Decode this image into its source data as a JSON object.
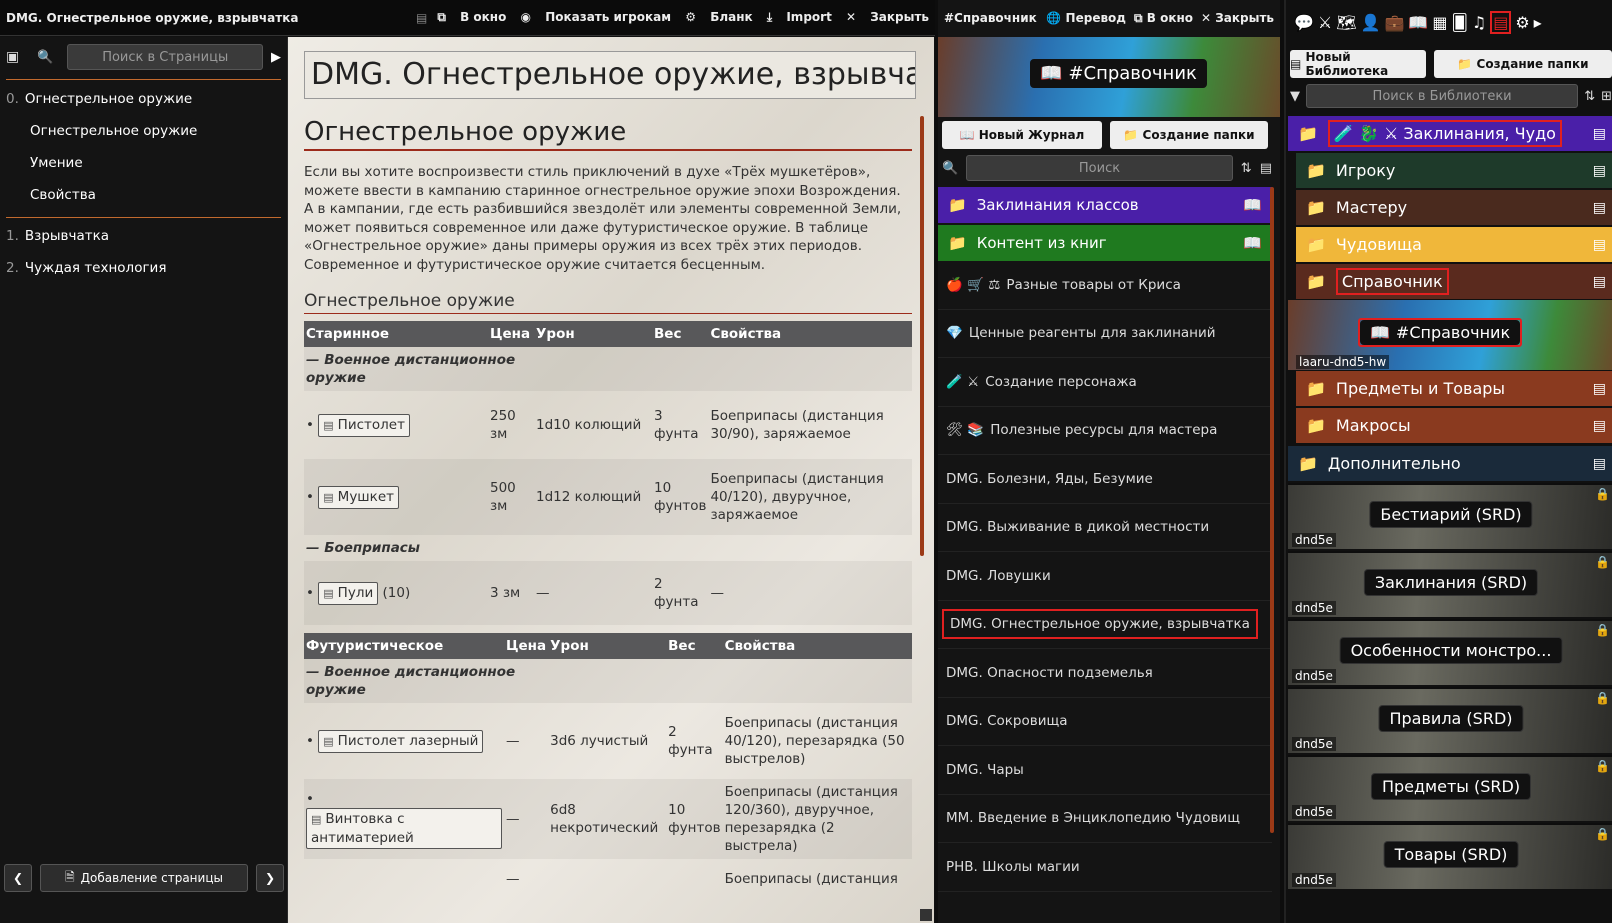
{
  "journal": {
    "title": "DMG. Огнестрельное оружие, взрывчатка",
    "toolbar": {
      "popout": "В окно",
      "show_players": "Показать игрокам",
      "blank": "Бланк",
      "import": "Import",
      "close": "Закрыть"
    },
    "search_placeholder": "Поиск в Страницы",
    "pages": [
      {
        "num": "0.",
        "label": "Огнестрельное оружие"
      },
      {
        "num": "",
        "label": "Огнестрельное оружие"
      },
      {
        "num": "",
        "label": "Умение"
      },
      {
        "num": "",
        "label": "Свойства"
      },
      {
        "num": "1.",
        "label": "Взрывчатка"
      },
      {
        "num": "2.",
        "label": "Чуждая технология"
      }
    ],
    "add_page": "Добавление страницы",
    "page_title": "DMG. Огнестрельное оружие, взрывчатка",
    "heading": "Огнестрельное оружие",
    "intro": "Если вы хотите воспроизвести стиль приключений в духе «Трёх мушкетёров», можете ввести в кампанию старинное огнестрельное оружие эпохи Возрождения. А в кампании, где есть разбившийся звездолёт или элементы современной Земли, может появиться современное или даже футуристическое оружие. В таблице «Огнестрельное оружие» даны примеры оружия из всех трёх этих периодов. Современное и футуристическое оружие считается бесценным.",
    "subheading": "Огнестрельное оружие",
    "table1": {
      "headers": [
        "Старинное",
        "Цена",
        "Урон",
        "Вес",
        "Свойства"
      ],
      "group1": "— Военное дистанционное оружие",
      "rows": [
        {
          "name": "Пистолет",
          "extra": "",
          "price": "250 зм",
          "damage": "1d10 колющий",
          "weight": "3 фунта",
          "props": "Боеприпасы (дистанция 30/90), заряжаемое"
        },
        {
          "name": "Мушкет",
          "extra": "",
          "price": "500 зм",
          "damage": "1d12 колющий",
          "weight": "10 фунтов",
          "props": "Боеприпасы (дистанция 40/120), двуручное, заряжаемое"
        }
      ],
      "group2": "— Боеприпасы",
      "ammo": {
        "name": "Пули",
        "extra": "(10)",
        "price": "3 зм",
        "damage": "—",
        "weight": "2 фунта",
        "props": "—"
      }
    },
    "table2": {
      "headers": [
        "Футуристическое",
        "Цена",
        "Урон",
        "Вес",
        "Свойства"
      ],
      "group1": "— Военное дистанционное оружие",
      "rows": [
        {
          "name": "Пистолет лазерный",
          "price": "—",
          "damage": "3d6 лучистый",
          "weight": "2 фунта",
          "props": "Боеприпасы (дистанция 40/120), перезарядка (50 выстрелов)"
        },
        {
          "name": "Винтовка с антиматерией",
          "price": "—",
          "damage": "6d8 некротический",
          "weight": "10 фунтов",
          "props": "Боеприпасы (дистанция 120/360), двуручное, перезарядка (2 выстрела)"
        },
        {
          "name": "",
          "price": "—",
          "damage": "",
          "weight": "",
          "props": "Боеприпасы (дистанция"
        }
      ]
    }
  },
  "handouts": {
    "title": "#Справочник",
    "toolbar": {
      "translate": "Перевод",
      "popout": "В окно",
      "close": "Закрыть"
    },
    "banner_tag": "#Справочник",
    "new_journal": "Новый Журнал",
    "new_folder": "Создание папки",
    "search_placeholder": "Поиск",
    "folders": [
      {
        "label": "Заклинания классов",
        "color": "#4a1fa8"
      },
      {
        "label": "Контент из книг",
        "color": "#1f7a1f"
      }
    ],
    "items": [
      {
        "icons": "🍎 🛒 ⚖",
        "label": "Разные товары от Криса"
      },
      {
        "icons": "💎",
        "label": "Ценные реагенты для заклинаний"
      },
      {
        "icons": "🧪 ⚔",
        "label": "Создание персонажа"
      },
      {
        "icons": "🛠 📚",
        "label": "Полезные ресурсы для мастера"
      },
      {
        "icons": "",
        "label": "DMG. Болезни, Яды, Безумие"
      },
      {
        "icons": "",
        "label": "DMG. Выживание в дикой местности"
      },
      {
        "icons": "",
        "label": "DMG. Ловушки"
      },
      {
        "icons": "",
        "label": "DMG. Огнестрельное оружие, взрывчатка"
      },
      {
        "icons": "",
        "label": "DMG. Опасности подземелья"
      },
      {
        "icons": "",
        "label": "DMG. Сокровища"
      },
      {
        "icons": "",
        "label": "DMG. Чары"
      },
      {
        "icons": "",
        "label": "MM. Введение в Энциклопедию Чудовищ"
      },
      {
        "icons": "",
        "label": "PHB. Школы магии"
      }
    ]
  },
  "library": {
    "new_library": "Новый Библиотека",
    "new_folder": "Создание папки",
    "search_placeholder": "Поиск в Библиотеки",
    "folders": [
      {
        "label": "🧪 🐉 ⚔ Заклинания, Чудо",
        "color": "#4a1fa8"
      },
      {
        "label": "Игроку",
        "color": "#1e3a2a"
      },
      {
        "label": "Мастеру",
        "color": "#4a2a1e"
      },
      {
        "label": "Чудовища",
        "color": "#f0b73a"
      },
      {
        "label": "Справочник",
        "color": "#5a2a1e"
      },
      {
        "label": "Предметы и Товары",
        "color": "#8a3a1f"
      },
      {
        "label": "Макросы",
        "color": "#8a3a1f"
      },
      {
        "label": "Дополнительно",
        "color": "#1a2a3a"
      }
    ],
    "ref_tag": "#Справочник",
    "ref_source": "laaru-dnd5-hw",
    "modules": [
      {
        "label": "Бестиарий (SRD)",
        "sys": "dnd5e"
      },
      {
        "label": "Заклинания (SRD)",
        "sys": "dnd5e"
      },
      {
        "label": "Особенности монстро...",
        "sys": "dnd5e"
      },
      {
        "label": "Правила (SRD)",
        "sys": "dnd5e"
      },
      {
        "label": "Предметы (SRD)",
        "sys": "dnd5e"
      },
      {
        "label": "Товары (SRD)",
        "sys": "dnd5e"
      }
    ]
  },
  "colors": {
    "accent": "#c26a2e",
    "highlight": "#e02020",
    "table_header": "#58585a"
  }
}
